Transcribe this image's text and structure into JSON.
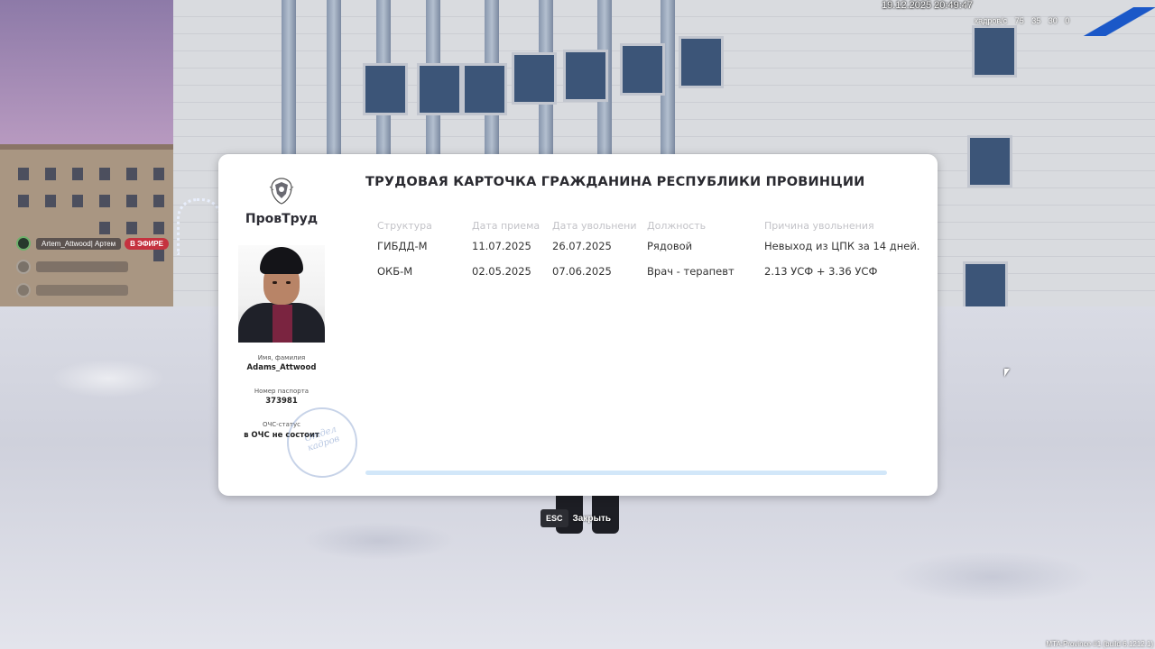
{
  "hud": {
    "datetime": "19.12.2025 20:49:47",
    "stats": [
      "кадров/с",
      "75",
      "35",
      "30",
      "0"
    ],
    "build": "MTA:Province #1 (build 6.1212.1)"
  },
  "voice_chat": [
    {
      "name": "Artem_Attwood| Артем",
      "badge": "В ЭФИРЕ"
    },
    {
      "name": "",
      "badge": ""
    },
    {
      "name": "",
      "badge": ""
    }
  ],
  "card": {
    "org_name": "ПровТруд",
    "title": "ТРУДОВАЯ КАРТОЧКА ГРАЖДАНИНА РЕСПУБЛИКИ ПРОВИНЦИИ",
    "person": {
      "name_label": "Имя, фамилия",
      "name": "Adams_Attwood",
      "passport_label": "Номер паспорта",
      "passport": "373981",
      "status_label": "ОЧС-статус",
      "status": "в ОЧС не состоит"
    },
    "stamp_text": "Отдел кадров",
    "columns": [
      "Структура",
      "Дата приема",
      "Дата увольнени",
      "Должность",
      "Причина увольнения"
    ],
    "rows": [
      [
        "ГИБДД-М",
        "11.07.2025",
        "26.07.2025",
        "Рядовой",
        "Невыход из ЦПК за 14 дней."
      ],
      [
        "ОКБ-М",
        "02.05.2025",
        "07.06.2025",
        "Врач - терапевт",
        "2.13 УСФ + 3.36 УСФ"
      ]
    ]
  },
  "close_hint": {
    "key": "ESC",
    "label": "Закрыть"
  }
}
